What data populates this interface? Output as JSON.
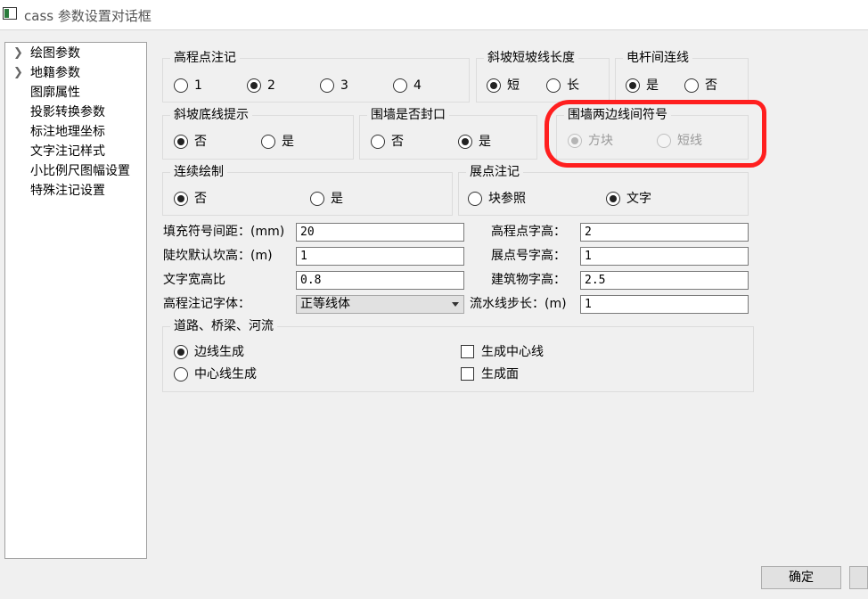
{
  "window": {
    "title": "cass 参数设置对话框"
  },
  "nav": {
    "items": [
      {
        "label": "绘图参数",
        "expandable": true
      },
      {
        "label": "地籍参数",
        "expandable": true
      },
      {
        "label": "图廓属性",
        "expandable": false
      },
      {
        "label": "投影转换参数",
        "expandable": false
      },
      {
        "label": "标注地理坐标",
        "expandable": false
      },
      {
        "label": "文字注记样式",
        "expandable": false
      },
      {
        "label": "小比例尺图幅设置",
        "expandable": false
      },
      {
        "label": "特殊注记设置",
        "expandable": false
      }
    ]
  },
  "groups": {
    "elevation_note": {
      "title": "高程点注记",
      "options": [
        "1",
        "2",
        "3",
        "4"
      ],
      "selected": "2"
    },
    "slope_length": {
      "title": "斜坡短坡线长度",
      "options": [
        "短",
        "长"
      ],
      "selected": "短"
    },
    "pole_line": {
      "title": "电杆间连线",
      "options": [
        "是",
        "否"
      ],
      "selected": "是"
    },
    "slope_bottom": {
      "title": "斜坡底线提示",
      "options": [
        "否",
        "是"
      ],
      "selected": "否"
    },
    "wall_closed": {
      "title": "围墙是否封口",
      "options": [
        "否",
        "是"
      ],
      "selected": "是"
    },
    "wall_symbol": {
      "title": "围墙两边线间符号",
      "options": [
        "方块",
        "短线"
      ],
      "selected": "方块",
      "disabled": true
    },
    "continuous": {
      "title": "连续绘制",
      "options": [
        "否",
        "是"
      ],
      "selected": "否"
    },
    "point_note": {
      "title": "展点注记",
      "options": [
        "块参照",
        "文字"
      ],
      "selected": "文字"
    },
    "road": {
      "title": "道路、桥梁、河流",
      "radios": [
        "边线生成",
        "中心线生成"
      ],
      "selected": "边线生成",
      "checks": [
        {
          "label": "生成中心线",
          "checked": false
        },
        {
          "label": "生成面",
          "checked": false
        }
      ]
    }
  },
  "fields": {
    "fill_spacing": {
      "label": "填充符号间距：(mm)",
      "value": "20"
    },
    "steep_height": {
      "label": "陡坎默认坎高：(m)",
      "value": "1"
    },
    "text_ratio": {
      "label": "文字宽高比",
      "value": "0.8"
    },
    "elev_font": {
      "label": "高程注记字体：",
      "value": "正等线体"
    },
    "elev_height": {
      "label": "高程点字高：",
      "value": "2"
    },
    "pointno_height": {
      "label": "展点号字高：",
      "value": "1"
    },
    "building_height": {
      "label": "建筑物字高：",
      "value": "2.5"
    },
    "flow_step": {
      "label": "流水线步长：(m)",
      "value": "1"
    }
  },
  "buttons": {
    "ok": "确定",
    "cancel": ""
  },
  "annotation": {
    "color": "#ff1f1f",
    "target": "围墙两边线间符号"
  }
}
